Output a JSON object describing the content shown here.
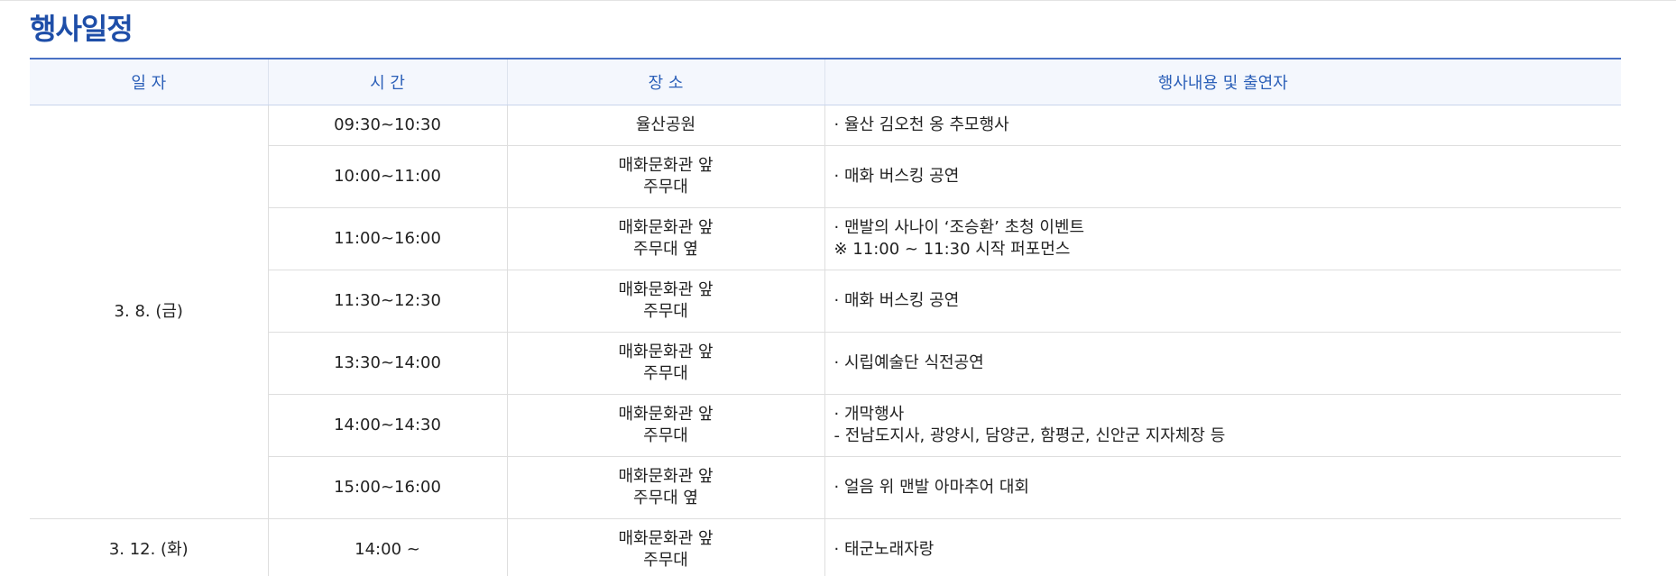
{
  "title": "행사일정",
  "table": {
    "headers": [
      "일 자",
      "시 간",
      "장 소",
      "행사내용 및 출연자"
    ],
    "groups": [
      {
        "date": "3. 8. (금)",
        "rows": [
          {
            "time": "09:30~10:30",
            "place": [
              "율산공원"
            ],
            "content": [
              "· 율산 김오천 옹 추모행사"
            ]
          },
          {
            "time": "10:00~11:00",
            "place": [
              "매화문화관 앞",
              "주무대"
            ],
            "content": [
              "· 매화 버스킹 공연"
            ]
          },
          {
            "time": "11:00~16:00",
            "place": [
              "매화문화관 앞",
              "주무대 옆"
            ],
            "content": [
              "· 맨발의 사나이 ‘조승환’ 초청 이벤트",
              "※ 11:00 ~ 11:30 시작 퍼포먼스"
            ]
          },
          {
            "time": "11:30~12:30",
            "place": [
              "매화문화관 앞",
              "주무대"
            ],
            "content": [
              "· 매화 버스킹 공연"
            ]
          },
          {
            "time": "13:30~14:00",
            "place": [
              "매화문화관 앞",
              "주무대"
            ],
            "content": [
              "· 시립예술단 식전공연"
            ]
          },
          {
            "time": "14:00~14:30",
            "place": [
              "매화문화관 앞",
              "주무대"
            ],
            "content": [
              "· 개막행사",
              "- 전남도지사, 광양시, 담양군, 함평군, 신안군 지자체장 등"
            ]
          },
          {
            "time": "15:00~16:00",
            "place": [
              "매화문화관 앞",
              "주무대 옆"
            ],
            "content": [
              "· 얼음 위 맨발 아마추어 대회"
            ]
          }
        ]
      },
      {
        "date": "3. 12. (화)",
        "rows": [
          {
            "time": "14:00 ~",
            "place": [
              "매화문화관 앞",
              "주무대"
            ],
            "content": [
              "· 태군노래자랑"
            ]
          }
        ]
      }
    ]
  }
}
